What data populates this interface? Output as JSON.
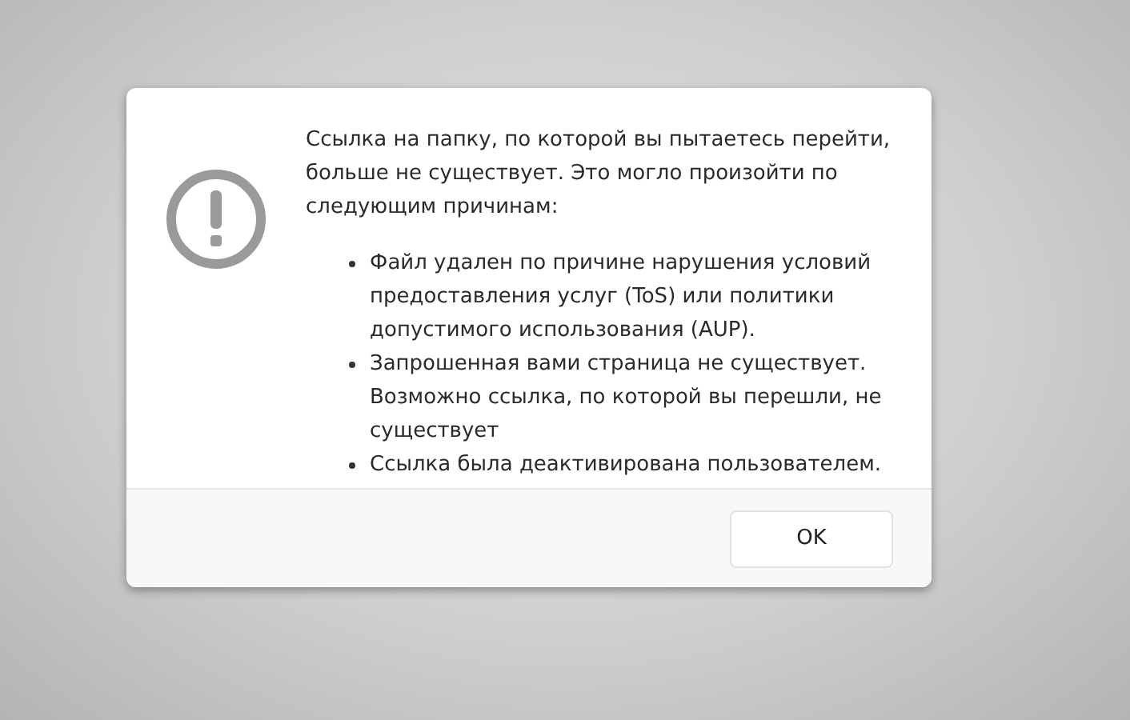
{
  "dialog": {
    "message": "Ссылка на папку, по которой вы пытаетесь перейти, больше не существует. Это могло произойти по следующим причинам:",
    "reasons": [
      "Файл удален по причине нарушения условий предоставления услуг (ToS) или политики допустимого использования (AUP).",
      "Запрошенная вами страница не существует. Возможно ссылка, по которой вы перешли, не существует",
      "Ссылка была деактивирована пользователем."
    ],
    "buttons": [
      "OK"
    ]
  }
}
